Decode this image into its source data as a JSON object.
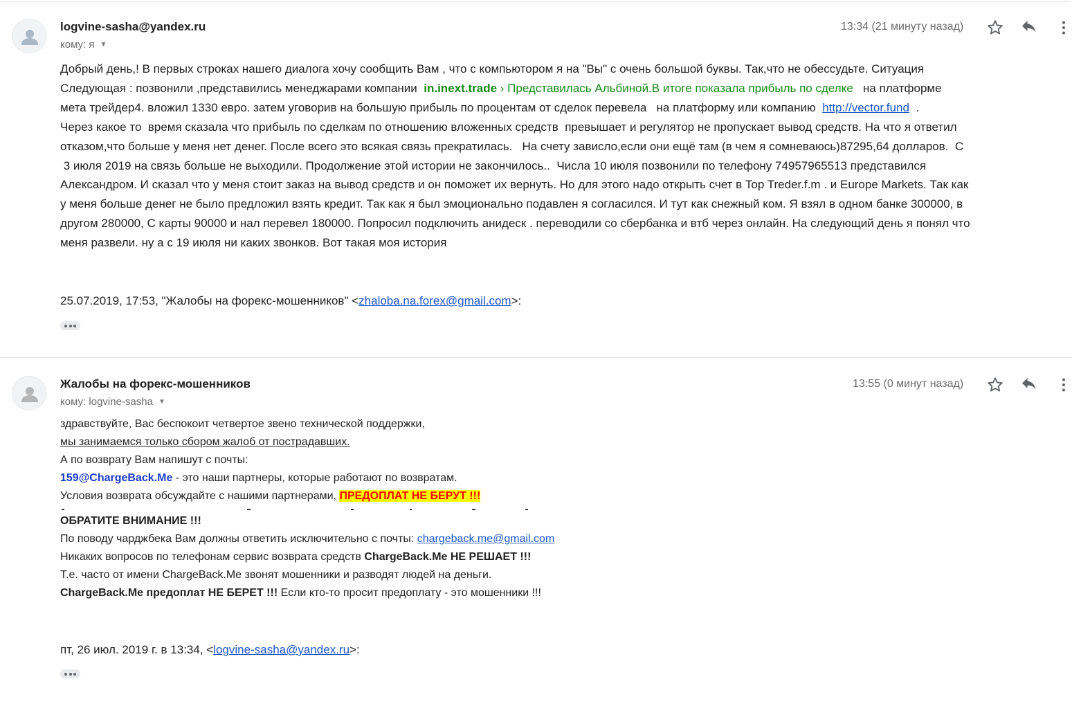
{
  "messages": [
    {
      "sender": "logvine-sasha@yandex.ru",
      "recipient": "кому: я",
      "time": "13:34 (21 минуту назад)",
      "body": {
        "l1": "Добрый день,! В первых строках нашего диалога хочу сообщить Вам , что с компьютором я на \"Вы\" с очень большой буквы. Так,что не обессудьте. Ситуация",
        "l2_a": "Следующая : позвонили ,представились менеджарами компании ",
        "l2_green_bold": "in.inext.trade",
        "l2_green": " › Представилась Альбиной.В итоге показала прибыль по сделке",
        "l2_b": "   на платформе",
        "l3_a": "мета трейдер4. вложил 1330 евро. затем уговорив на большую прибыль по процентам от сделок перевела   на платформу или компанию  ",
        "l3_link": "http://vector.fund",
        "l3_b": "  .",
        "l4": "Через какое то  время сказала что прибыль по сделкам по отношению вложенных средств  превышает и регулятор не пропускает вывод средств. На что я ответил",
        "l5": "отказом,что больше у меня нет денег. После всего это всякая связь прекратилась.   На счету зависло,если они ещё там (в чем я сомневаюсь)87295,64 долларов.  С",
        "l6": " 3 июля 2019 на связь больше не выходили. Продолжение этой истории не закончилось..  Числа 10 июля позвонили по телефону 74957965513 представился",
        "l7": "Александром. И сказал что у меня стоит заказ на вывод средств и он поможет их вернуть. Но для этого надо открыть счет в Top Treder.f.m . и Europe Markets. Так как",
        "l8": "у меня больше денег не было предложил взять кредит. Так как я был эмоционально подавлен я согласился. И тут как снежный ком. Я взял в одном банке 300000, в",
        "l9": "другом 280000, С карты 90000 и нал перевел 180000. Попросил подключить анидеск . переводили со сбербанка и втб через онлайн. На следующий день я понял что",
        "l10": "меня развели. ну а с 19 июля ни каких звонков. Вот такая моя история"
      },
      "quote": {
        "prefix": "25.07.2019, 17:53, \"Жалобы на форекс-мошенников\" <",
        "email": "zhaloba.na.forex@gmail.com",
        "suffix": ">:"
      }
    },
    {
      "sender": "Жалобы на форекс-мошенников",
      "recipient": "кому: logvine-sasha",
      "time": "13:55 (0 минут назад)",
      "body": {
        "l1": "здравствуйте, Вас беспокоит четвертое звено технической поддержки,",
        "l2": "мы занимаемся только сбором жалоб от пострадавших.",
        "l3": "А по возврату Вам напишут с почты:",
        "l4_email": "159@ChargeBack.Me",
        "l4_rest": " - это наши партнеры, которые работают по возвратам.",
        "l5_a": "Условия возврата обсуждайте с нашими партнерами, ",
        "l5_hl": "ПРЕДОПЛАТ НЕ БЕРУТ !!!",
        "l6": "ОБРАТИТЕ ВНИМАНИЕ !!!",
        "l7_a": "По поводу чарджбека Вам должны ответить исключительно с почты: ",
        "l7_link": "chargeback.me@gmail.com",
        "l8_a": "Никаких вопросов по телефонам сервис возврата средств ",
        "l8_b": "ChargeBack.Me НЕ РЕШАЕТ !!!",
        "l9": "Т.е. часто от имени ChargeBack.Me звонят мошенники и разводят людей на деньги.",
        "l10_a": "ChargeBack.Me предоплат НЕ БЕРЕТ !!!",
        "l10_b": " Если кто-то просит предоплату - это мошенники !!!"
      },
      "quote": {
        "prefix": "пт, 26 июл. 2019 г. в 13:34, <",
        "email": "logvine-sasha@yandex.ru",
        "suffix": ">:"
      }
    }
  ],
  "icons": {
    "star": "star-icon",
    "reply": "reply-icon",
    "more": "more-vert-icon",
    "avatar": "person-icon",
    "expand": "more-horiz-icon"
  },
  "colors": {
    "green": "#158c15",
    "link": "#1a56c8",
    "highlight_bg": "#ffff00",
    "highlight_text": "#ff0000",
    "blue_bold": "#1a3cc8"
  }
}
